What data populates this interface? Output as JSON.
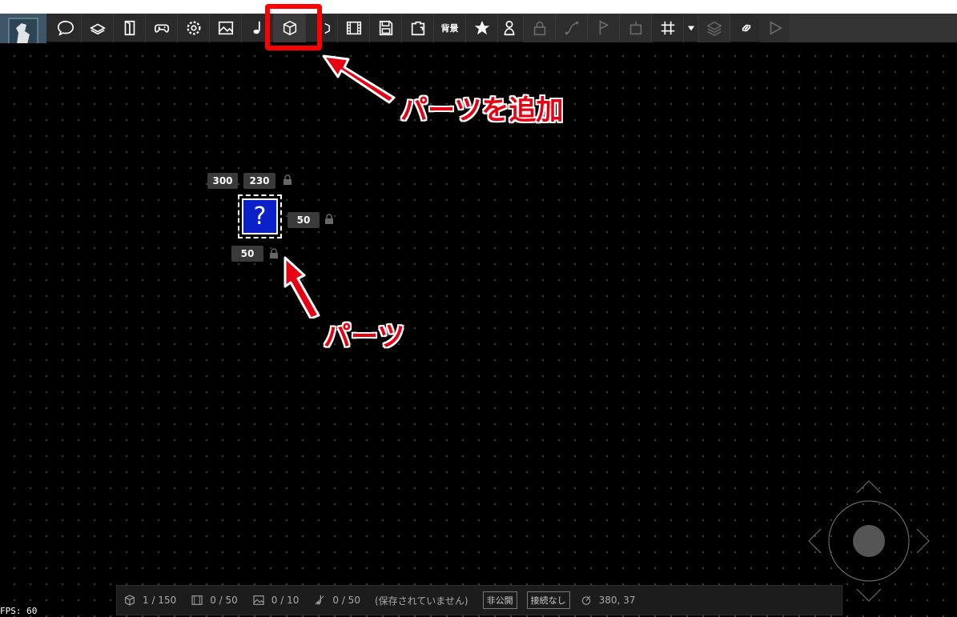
{
  "toolbar": {
    "bg_label": "背景",
    "buttons": [
      "logo-icon",
      "speech-bubble-icon",
      "book-stack-icon",
      "door-icon",
      "gamepad-icon",
      "gear-icon",
      "image-icon",
      "music-note-icon",
      "cube-icon",
      "cube-small-icon",
      "film-icon",
      "save-icon",
      "export-icon",
      "background-text",
      "star-icon",
      "person-icon",
      "lock-icon",
      "path-icon",
      "flag-icon",
      "robot-icon",
      "grid-icon",
      "dropdown-icon",
      "layers-icon",
      "link-icon",
      "play-icon"
    ]
  },
  "annotations": {
    "add_parts": "パーツを追加",
    "parts": "パーツ"
  },
  "part": {
    "x": "300",
    "y": "230",
    "width": "50",
    "height": "50",
    "symbol": "?"
  },
  "status": {
    "parts_count": "1 / 150",
    "frames_count": "0 / 50",
    "images_count": "0 / 10",
    "sounds_count": "0 / 50",
    "save_state": "(保存されていません)",
    "visibility": "非公開",
    "connection": "接続なし",
    "cursor_pos": "380, 37"
  },
  "fps": "FPS: 60",
  "colors": {
    "annotation_red": "#e60012",
    "part_blue": "#0a20c8",
    "toolbar_bg": "#2a2a2a"
  }
}
